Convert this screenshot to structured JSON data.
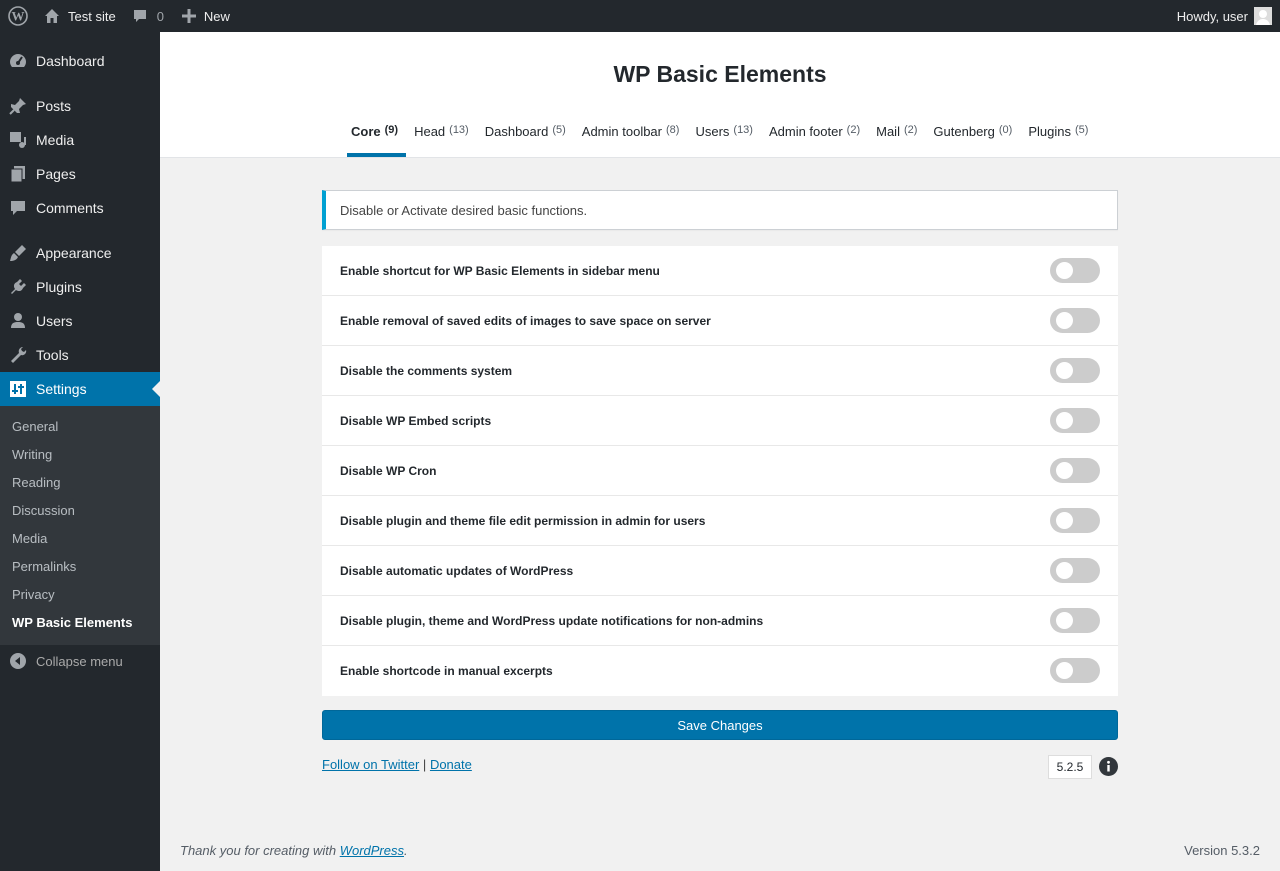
{
  "adminbar": {
    "site_name": "Test site",
    "comments_count": "0",
    "new_label": "New",
    "howdy": "Howdy, user"
  },
  "sidebar": {
    "items": [
      {
        "label": "Dashboard",
        "icon": "dashboard-icon"
      },
      {
        "label": "Posts",
        "icon": "pin-icon"
      },
      {
        "label": "Media",
        "icon": "media-icon"
      },
      {
        "label": "Pages",
        "icon": "pages-icon"
      },
      {
        "label": "Comments",
        "icon": "comment-icon"
      },
      {
        "label": "Appearance",
        "icon": "brush-icon"
      },
      {
        "label": "Plugins",
        "icon": "plug-icon"
      },
      {
        "label": "Users",
        "icon": "user-icon"
      },
      {
        "label": "Tools",
        "icon": "wrench-icon"
      },
      {
        "label": "Settings",
        "icon": "settings-icon"
      }
    ],
    "submenu": [
      "General",
      "Writing",
      "Reading",
      "Discussion",
      "Media",
      "Permalinks",
      "Privacy",
      "WP Basic Elements"
    ],
    "collapse_label": "Collapse menu"
  },
  "header": {
    "title": "WP Basic Elements",
    "tabs": [
      {
        "label": "Core",
        "count": "(9)"
      },
      {
        "label": "Head",
        "count": "(13)"
      },
      {
        "label": "Dashboard",
        "count": "(5)"
      },
      {
        "label": "Admin toolbar",
        "count": "(8)"
      },
      {
        "label": "Users",
        "count": "(13)"
      },
      {
        "label": "Admin footer",
        "count": "(2)"
      },
      {
        "label": "Mail",
        "count": "(2)"
      },
      {
        "label": "Gutenberg",
        "count": "(0)"
      },
      {
        "label": "Plugins",
        "count": "(5)"
      }
    ]
  },
  "notice": "Disable or Activate desired basic functions.",
  "options": [
    {
      "label": "Enable shortcut for WP Basic Elements in sidebar menu",
      "on": false
    },
    {
      "label": "Enable removal of saved edits of images to save space on server",
      "on": false
    },
    {
      "label": "Disable the comments system",
      "on": false
    },
    {
      "label": "Disable WP Embed scripts",
      "on": false
    },
    {
      "label": "Disable WP Cron",
      "on": false
    },
    {
      "label": "Disable plugin and theme file edit permission in admin for users",
      "on": false
    },
    {
      "label": "Disable automatic updates of WordPress",
      "on": false
    },
    {
      "label": "Disable plugin, theme and WordPress update notifications for non-admins",
      "on": false
    },
    {
      "label": "Enable shortcode in manual excerpts",
      "on": false
    }
  ],
  "save_label": "Save Changes",
  "links": {
    "twitter": "Follow on Twitter",
    "separator": "|",
    "donate": "Donate"
  },
  "plugin_version": "5.2.5",
  "footer": {
    "thanks_prefix": "Thank you for creating with ",
    "wordpress_link": "WordPress",
    "thanks_suffix": ".",
    "version": "Version 5.3.2"
  },
  "colors": {
    "accent": "#0073aa",
    "admin_bg": "#23282d",
    "notice_border": "#00a0d2"
  }
}
